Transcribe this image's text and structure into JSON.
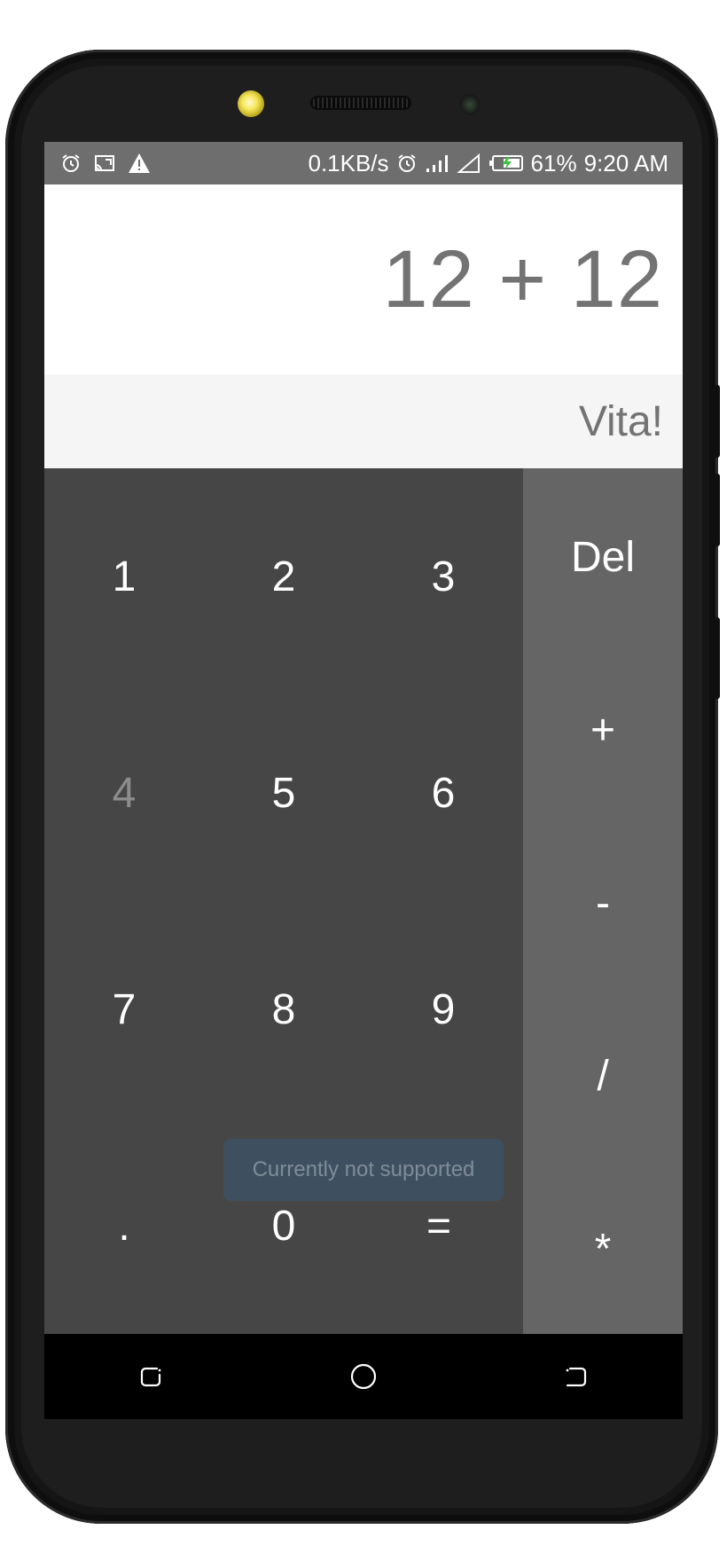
{
  "status_bar": {
    "network_speed": "0.1KB/s",
    "battery_percent": "61%",
    "time": "9:20 AM",
    "icons": [
      "alarm-icon",
      "cast-icon",
      "warning-icon",
      "alarm-icon",
      "signal-icon",
      "signal-empty-icon",
      "battery-charging-icon"
    ]
  },
  "display": {
    "expression": "12 + 12",
    "result": "Vita!"
  },
  "keypad": {
    "keys": [
      "1",
      "2",
      "3",
      "4",
      "5",
      "6",
      "7",
      "8",
      "9",
      ".",
      "0",
      "="
    ]
  },
  "operators": {
    "keys": [
      "Del",
      "+",
      "-",
      "/",
      "*"
    ]
  },
  "toast": {
    "message": "Currently not supported"
  },
  "nav_bar": {
    "icons": [
      "recent-apps-icon",
      "home-icon",
      "back-icon"
    ]
  },
  "colors": {
    "status_bar": "#6e6e6e",
    "display_bg": "#ffffff",
    "result_bg": "#f5f5f5",
    "numpad_bg": "#464646",
    "operators_bg": "#656565",
    "toast_bg": "#3e5060",
    "nav_bar": "#000000"
  }
}
